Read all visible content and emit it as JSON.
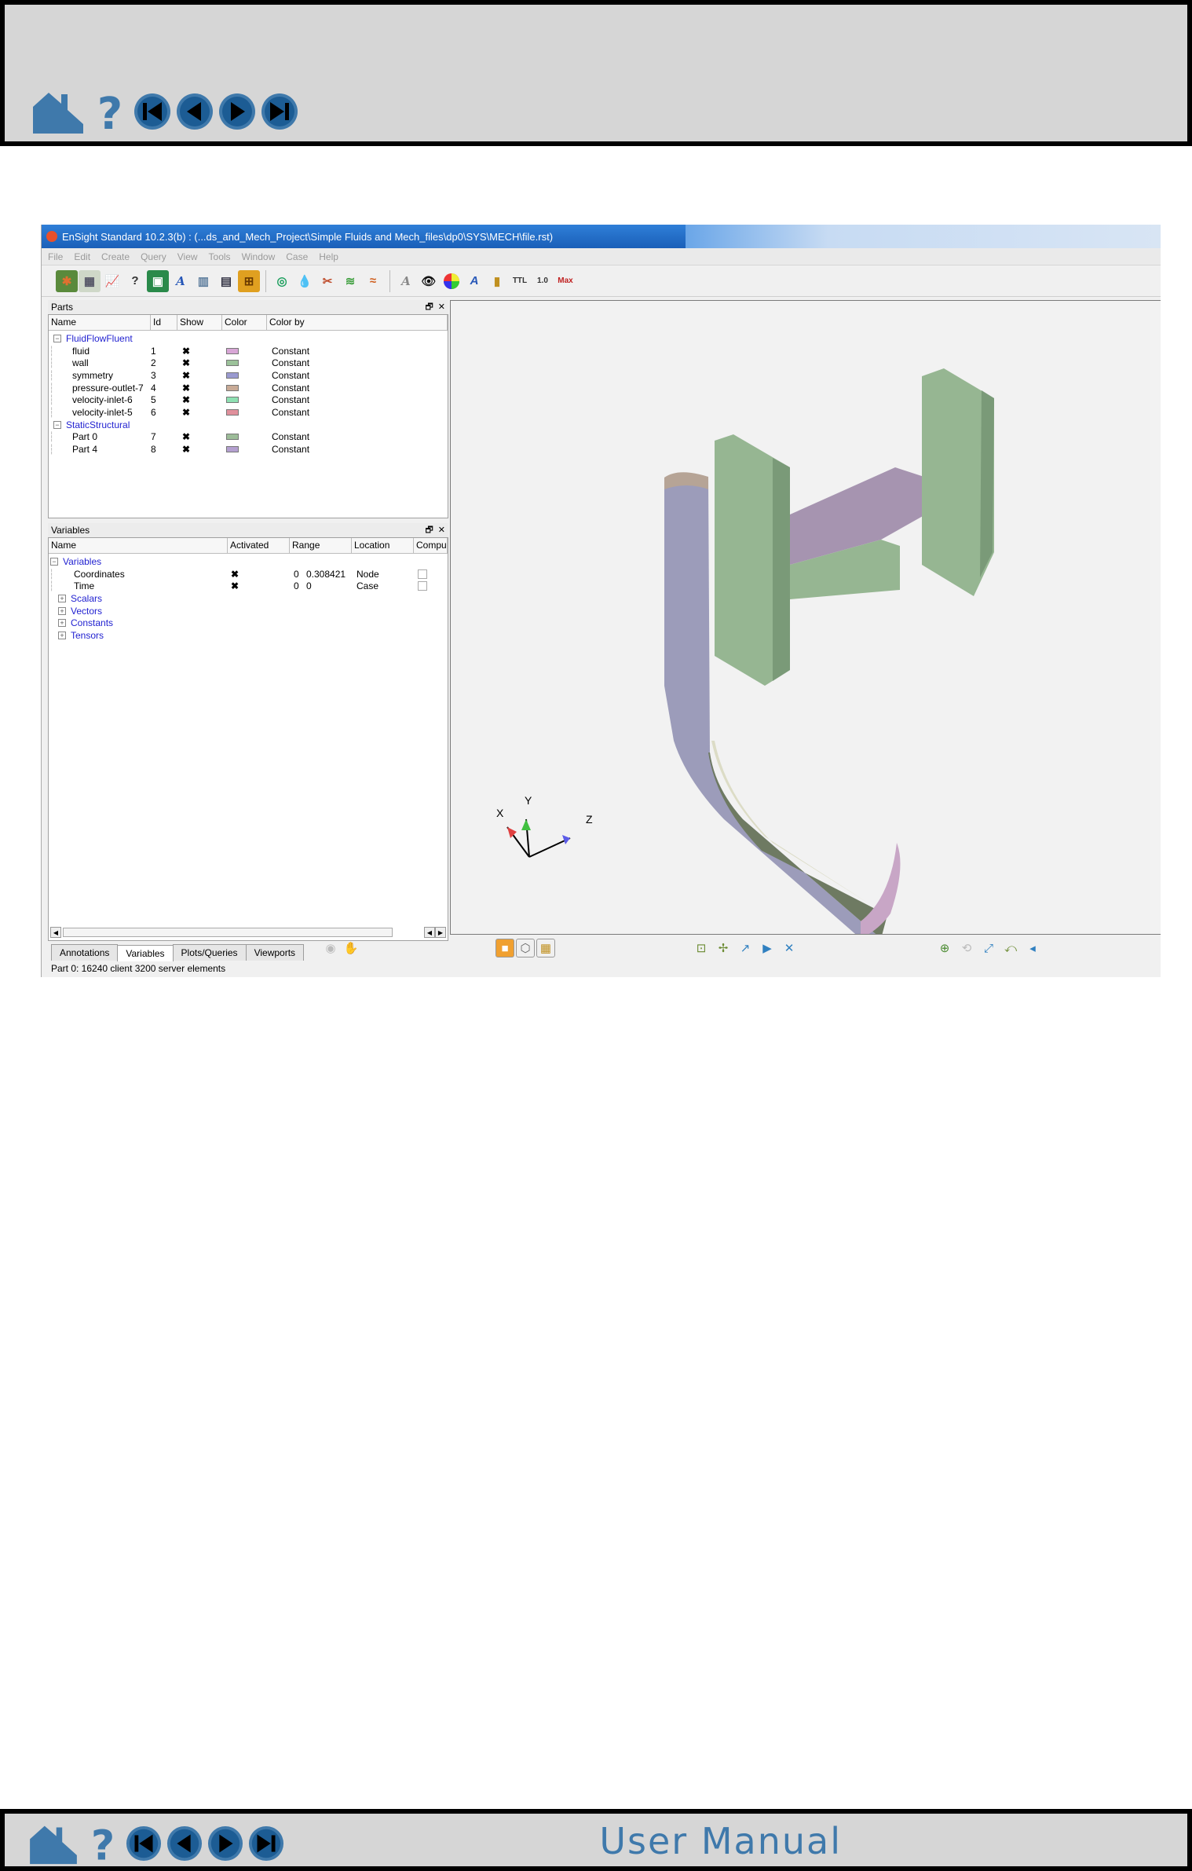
{
  "page": {
    "footer_title": "User Manual",
    "nav_icons": [
      "home-icon",
      "help-icon",
      "first-page-icon",
      "previous-page-icon",
      "next-page-icon",
      "last-page-icon"
    ],
    "accent_color": "#3f79ab"
  },
  "app": {
    "window_title": "EnSight Standard 10.2.3(b) :  (...ds_and_Mech_Project\\Simple Fluids and Mech_files\\dp0\\SYS\\MECH\\file.rst)",
    "menu": [
      "File",
      "Edit",
      "Create",
      "Query",
      "View",
      "Tools",
      "Window",
      "Case",
      "Help"
    ],
    "parts_panel": {
      "title": "Parts",
      "columns": [
        "Name",
        "Id",
        "Show",
        "Color",
        "Color by"
      ],
      "groups": [
        {
          "name": "FluidFlowFluent",
          "items": [
            {
              "name": "fluid",
              "id": "1",
              "color": "#d8a6d6",
              "color_by": "Constant"
            },
            {
              "name": "wall",
              "id": "2",
              "color": "#9cc29a",
              "color_by": "Constant"
            },
            {
              "name": "symmetry",
              "id": "3",
              "color": "#9a9ad0",
              "color_by": "Constant"
            },
            {
              "name": "pressure-outlet-7",
              "id": "4",
              "color": "#c8aa96",
              "color_by": "Constant"
            },
            {
              "name": "velocity-inlet-6",
              "id": "5",
              "color": "#8ee0b2",
              "color_by": "Constant"
            },
            {
              "name": "velocity-inlet-5",
              "id": "6",
              "color": "#e0909c",
              "color_by": "Constant"
            }
          ]
        },
        {
          "name": "StaticStructural",
          "items": [
            {
              "name": "Part 0",
              "id": "7",
              "color": "#9cbc98",
              "color_by": "Constant"
            },
            {
              "name": "Part 4",
              "id": "8",
              "color": "#b4a0d0",
              "color_by": "Constant"
            }
          ]
        }
      ]
    },
    "variables_panel": {
      "title": "Variables",
      "columns": [
        "Name",
        "Activated",
        "Range",
        "Location",
        "Compu"
      ],
      "root": "Variables",
      "items": [
        {
          "name": "Coordinates",
          "range_min": "0",
          "range_max": "0.308421",
          "location": "Node"
        },
        {
          "name": "Time",
          "range_min": "0",
          "range_max": "0",
          "location": "Case"
        }
      ],
      "groups": [
        "Scalars",
        "Vectors",
        "Constants",
        "Tensors"
      ]
    },
    "tabs": [
      "Annotations",
      "Variables",
      "Plots/Queries",
      "Viewports"
    ],
    "active_tab": "Variables",
    "axes": {
      "x": "X",
      "y": "Y",
      "z": "Z"
    },
    "status": "Part 0: 16240 client 3200 server elements"
  }
}
